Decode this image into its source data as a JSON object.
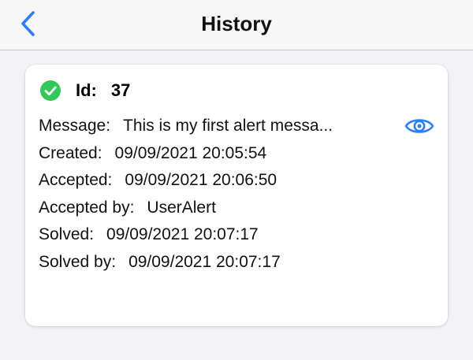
{
  "header": {
    "title": "History",
    "back_icon": "chevron-left-icon",
    "accent_color": "#2d7ff9"
  },
  "alert": {
    "status_icon": "check-circle-icon",
    "status_color": "#34c759",
    "id_label": "Id:",
    "id_value": "37",
    "view_icon": "eye-icon",
    "fields": [
      {
        "label": "Message:",
        "value": "This is my first alert messa..."
      },
      {
        "label": "Created:",
        "value": "09/09/2021 20:05:54"
      },
      {
        "label": "Accepted:",
        "value": "09/09/2021 20:06:50"
      },
      {
        "label": "Accepted by:",
        "value": "UserAlert"
      },
      {
        "label": "Solved:",
        "value": "09/09/2021 20:07:17"
      },
      {
        "label": "Solved by:",
        "value": "09/09/2021 20:07:17"
      }
    ]
  }
}
